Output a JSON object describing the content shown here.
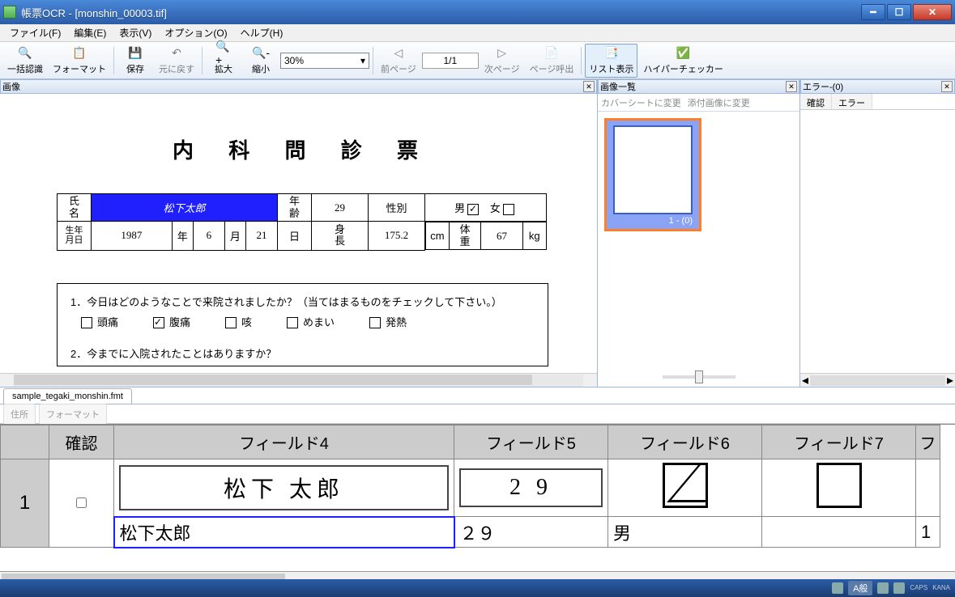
{
  "window": {
    "title": "帳票OCR - [monshin_00003.tif]"
  },
  "menu": {
    "file": "ファイル(F)",
    "edit": "編集(E)",
    "view": "表示(V)",
    "option": "オプション(O)",
    "help": "ヘルプ(H)"
  },
  "toolbar": {
    "recognize": "一括認識",
    "format": "フォーマット",
    "save": "保存",
    "undo": "元に戻す",
    "zoomin": "拡大",
    "zoomout": "縮小",
    "zoom_value": "30%",
    "zoom_chevron": "▾",
    "prev": "前ページ",
    "page": "1/1",
    "next": "次ページ",
    "pagecall": "ページ呼出",
    "listview": "リスト表示",
    "hyper": "ハイパーチェッカー"
  },
  "panels": {
    "image": "画像",
    "imagelist": "画像一覧",
    "error": "エラー-(0)",
    "cover": "カバーシートに変更",
    "attach": "添付画像に変更",
    "err_col1": "確認",
    "err_col2": "エラー",
    "thumb_num": "1 - (0)"
  },
  "doc": {
    "title": "内 科 問 診 票",
    "l_name": "氏\n名",
    "name": "松下太郎",
    "l_age": "年\n齢",
    "age": "29",
    "l_sex": "性別",
    "male": "男",
    "female": "女",
    "l_birth": "生年\n月日",
    "birth": "1987",
    "y": "年",
    "m1": "6",
    "m": "月",
    "d1": "21",
    "d": "日",
    "l_height": "身\n長",
    "height": "175.2",
    "cm": "cm",
    "l_weight": "体\n重",
    "weight": "67",
    "kg": "kg",
    "q1": "1．今日はどのようなことで来院されましたか？（当てはまるものをチェックして下さい。）",
    "a1": "頭痛",
    "a2": "腹痛",
    "a3": "咳",
    "a4": "めまい",
    "a5": "発熱",
    "q2": "2．今までに入院されたことはありますか？"
  },
  "tabs": {
    "file": "sample_tegaki_monshin.fmt",
    "addr": "住所",
    "format": "フォーマット"
  },
  "grid": {
    "h_conf": "確認",
    "h4": "フィールド4",
    "h5": "フィールド5",
    "h6": "フィールド6",
    "h7": "フィールド7",
    "h8": "フ",
    "row1": "1",
    "img4": "松下 太郎",
    "img5": "2 9",
    "v4": "松下太郎",
    "v5": "２９",
    "v6": "男",
    "v7": "",
    "v8": "1"
  },
  "status": {
    "ime": "A般",
    "caps": "CAPS",
    "kana": "KANA"
  }
}
